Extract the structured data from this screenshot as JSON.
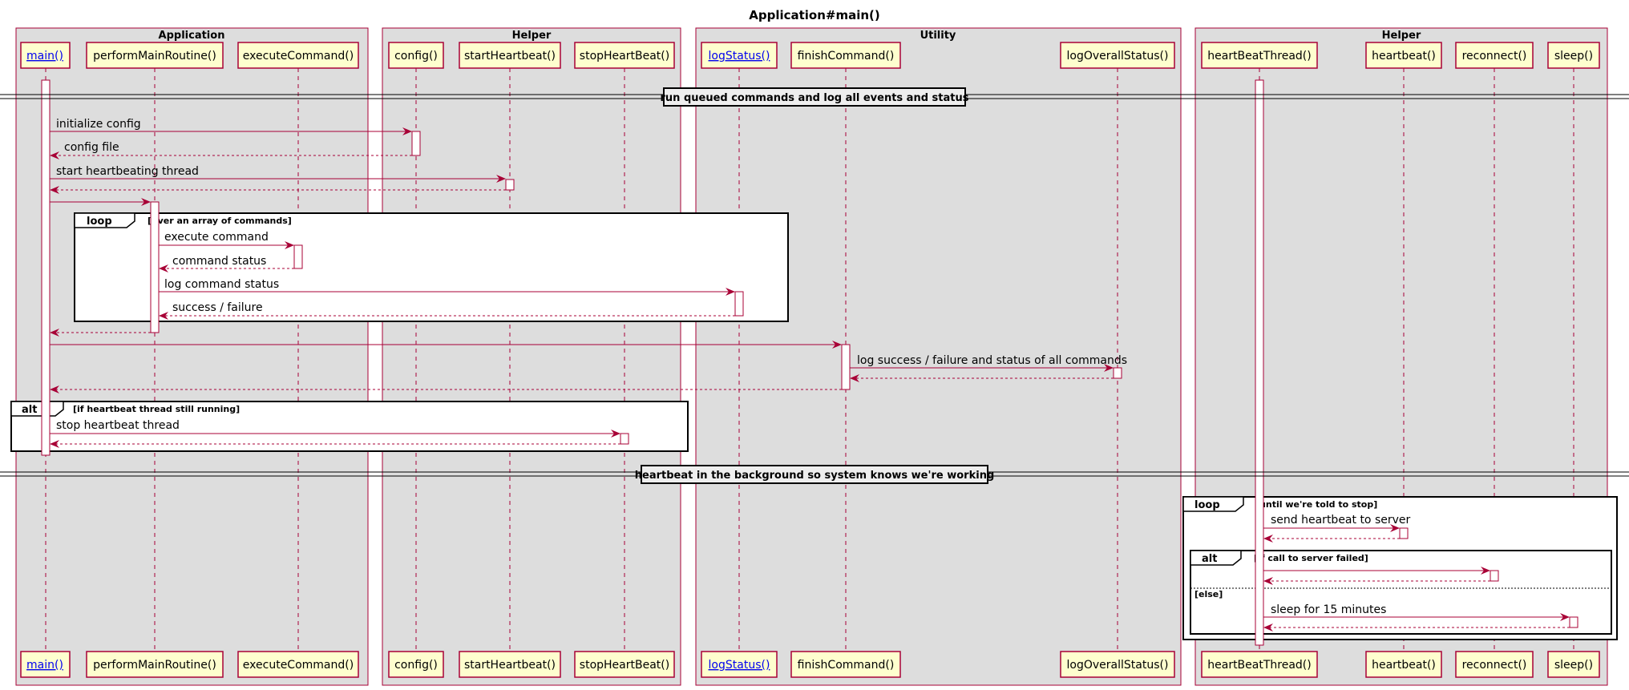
{
  "title": "Application#main()",
  "colors": {
    "line": "#a80036",
    "participant_fill": "#fefece",
    "group_fill": "#dddddd",
    "activation_fill": "#ffffff",
    "link": "#0000ee"
  },
  "groups": [
    {
      "label": "Application"
    },
    {
      "label": "Helper"
    },
    {
      "label": "Utility"
    },
    {
      "label": "Helper"
    }
  ],
  "participants": [
    {
      "label": "main()",
      "link": true
    },
    {
      "label": "performMainRoutine()",
      "link": false
    },
    {
      "label": "executeCommand()",
      "link": false
    },
    {
      "label": "config()",
      "link": false
    },
    {
      "label": "startHeartbeat()",
      "link": false
    },
    {
      "label": "stopHeartBeat()",
      "link": false
    },
    {
      "label": "logStatus()",
      "link": true
    },
    {
      "label": "finishCommand()",
      "link": false
    },
    {
      "label": "logOverallStatus()",
      "link": false
    },
    {
      "label": "heartBeatThread()",
      "link": false
    },
    {
      "label": "heartbeat()",
      "link": false
    },
    {
      "label": "reconnect()",
      "link": false
    },
    {
      "label": "sleep()",
      "link": false
    }
  ],
  "dividers": [
    {
      "label": "run queued commands and log all events and status"
    },
    {
      "label": "heartbeat in the background so system knows we're working"
    }
  ],
  "messages": [
    {
      "label": "initialize config"
    },
    {
      "label": "config file"
    },
    {
      "label": "start heartbeating thread"
    },
    {
      "label": ""
    },
    {
      "label": ""
    },
    {
      "label": "execute command"
    },
    {
      "label": "command status"
    },
    {
      "label": "log command status"
    },
    {
      "label": "success / failure"
    },
    {
      "label": ""
    },
    {
      "label": ""
    },
    {
      "label": "log success / failure and status of all commands"
    },
    {
      "label": ""
    },
    {
      "label": ""
    },
    {
      "label": "stop heartbeat thread"
    },
    {
      "label": ""
    },
    {
      "label": "send heartbeat to server"
    },
    {
      "label": ""
    },
    {
      "label": ""
    },
    {
      "label": ""
    },
    {
      "label": "sleep for 15 minutes"
    },
    {
      "label": ""
    }
  ],
  "fragments": [
    {
      "keyword": "loop",
      "condition": "[over an array of commands]"
    },
    {
      "keyword": "alt",
      "condition": "[if heartbeat thread still running]"
    },
    {
      "keyword": "loop",
      "condition": "[until we're told to stop]"
    },
    {
      "keyword": "alt",
      "condition": "[if call to server failed]",
      "else": "[else]"
    }
  ]
}
